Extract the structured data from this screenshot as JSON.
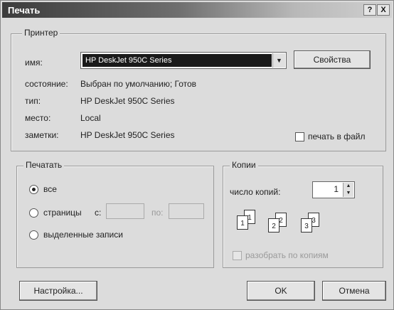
{
  "window": {
    "title": "Печать",
    "help_label": "?",
    "close_label": "X"
  },
  "printer": {
    "group_label": "Принтер",
    "name_label": "имя:",
    "name_value": "HP DeskJet 950C Series",
    "properties_button": "Свойства",
    "status_label": "состояние:",
    "status_value": "Выбран по умолчанию; Готов",
    "type_label": "тип:",
    "type_value": "HP DeskJet 950C Series",
    "location_label": "место:",
    "location_value": "Local",
    "notes_label": "заметки:",
    "notes_value": "HP DeskJet 950C Series",
    "print_to_file_label": "печать в файл",
    "print_to_file_checked": false
  },
  "range": {
    "group_label": "Печатать",
    "all_label": "все",
    "pages_label": "страницы",
    "from_label": "с:",
    "to_label": "по:",
    "from_value": "",
    "to_value": "",
    "selection_label": "выделенные записи",
    "selected": "all"
  },
  "copies": {
    "group_label": "Копии",
    "count_label": "число копий:",
    "count_value": "1",
    "collate_label": "разобрать по копиям",
    "collate_enabled": false,
    "page_numbers": [
      "1",
      "1",
      "2",
      "2",
      "3",
      "3"
    ]
  },
  "buttons": {
    "setup": "Настройка...",
    "ok": "OK",
    "cancel": "Отмена"
  },
  "colors": {
    "title_dark": "#3c3c3c",
    "dialog_bg": "#dcdcdc",
    "selection_bg": "#1a1a1a"
  }
}
